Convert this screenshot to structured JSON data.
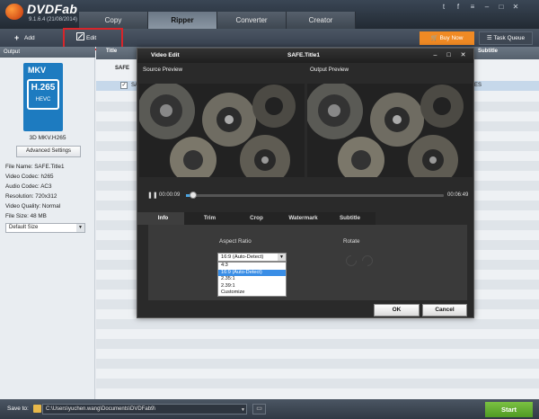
{
  "app": {
    "logo": "DVDFab",
    "version": "9.1.6.4 (21/08/2014)"
  },
  "tabs": [
    {
      "label": "Copy"
    },
    {
      "label": "Ripper"
    },
    {
      "label": "Converter"
    },
    {
      "label": "Creator"
    }
  ],
  "active_tab": "Ripper",
  "toolbar": {
    "add_label": "Add",
    "edit_label": "Edit",
    "buynow_label": "Buy Now",
    "taskqueue_label": "Task Queue"
  },
  "left_panel": {
    "header": "Output",
    "format_badge_top": "MKV",
    "format_badge_main": "H.265",
    "format_badge_sub": "HEVC",
    "format_name": "3D MKV.H265",
    "advanced_button": "Advanced Settings",
    "info": [
      "File Name: SAFE.Title1",
      "Video Codec: h265",
      "Audio Codec: AC3",
      "Resolution: 720x312",
      "Video Quality: Normal",
      "File Size: 48 MB"
    ],
    "size_select": "Default Size"
  },
  "list": {
    "header_col1": "Title",
    "header_col2": "Subtitle",
    "group_label": "SAFE",
    "row_label": "SAFE",
    "row_tail": "ES"
  },
  "dialog": {
    "title": "Video Edit",
    "subtitle": "SAFE.Title1",
    "source_preview": "Source Preview",
    "output_preview": "Output Preview",
    "time_current": "00:00:09",
    "time_total": "00:06:49",
    "progress": 0.02,
    "tabs": [
      {
        "label": "Info"
      },
      {
        "label": "Trim"
      },
      {
        "label": "Crop"
      },
      {
        "label": "Watermark"
      },
      {
        "label": "Subtitle"
      }
    ],
    "active_tab": "Info",
    "aspect_ratio_label": "Aspect Ratio",
    "rotate_label": "Rotate",
    "aspect_selected": "16:9 (Auto-Detect)",
    "aspect_options": [
      "4:3",
      "16:9 (Auto-Detect)",
      "2.35:1",
      "2.39:1",
      "Customize"
    ],
    "ok_label": "OK",
    "cancel_label": "Cancel"
  },
  "bottom": {
    "save_to_label": "Save to:",
    "path": "C:\\Users\\yuchen.wang\\Documents\\DVDFab9\\",
    "start_label": "Start"
  },
  "colors": {
    "accent": "#f08a24",
    "start": "#5fad2e",
    "highlight": "#d8252a",
    "selection": "#3a8ee6"
  }
}
